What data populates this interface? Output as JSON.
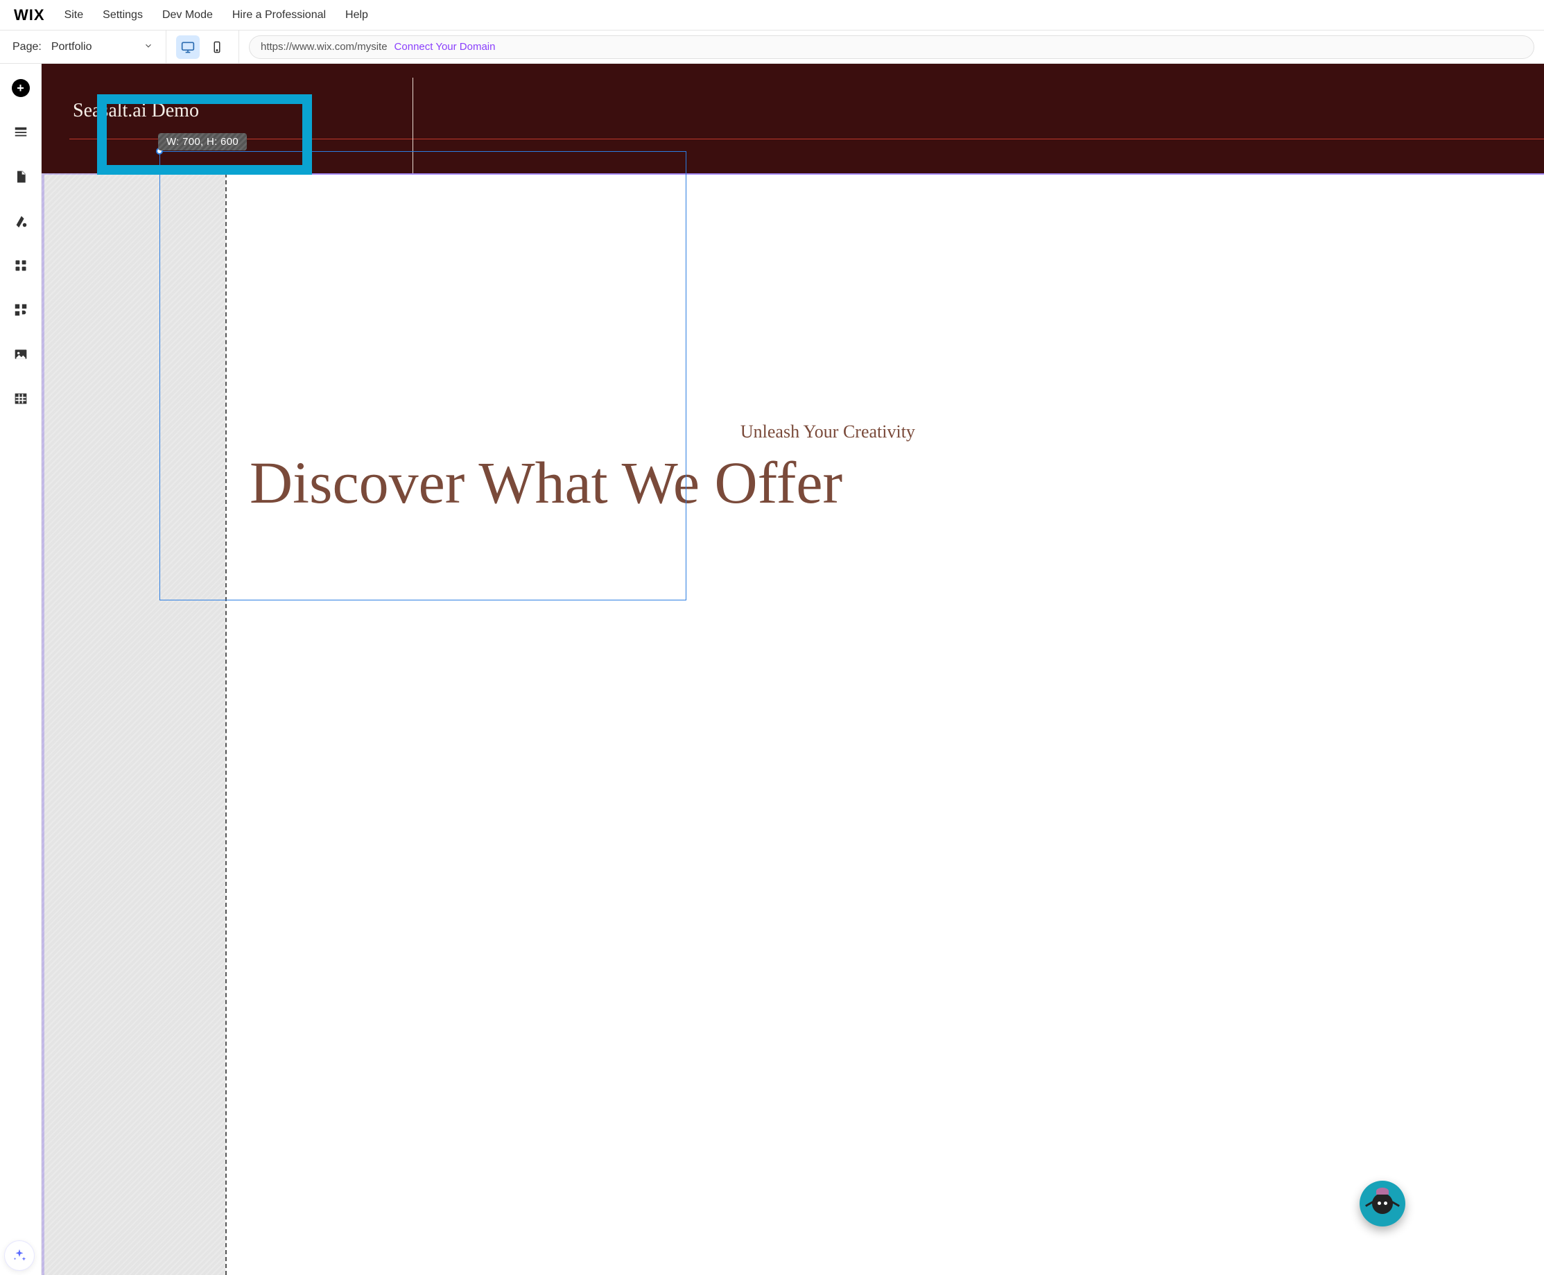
{
  "topMenu": {
    "logo": "WIX",
    "items": [
      "Site",
      "Settings",
      "Dev Mode",
      "Hire a Professional",
      "Help"
    ]
  },
  "pageBar": {
    "label": "Page:",
    "current": "Portfolio"
  },
  "deviceToggle": {
    "desktopActive": true
  },
  "urlBar": {
    "url": "https://www.wix.com/mysite",
    "connectText": "Connect Your Domain"
  },
  "leftRail": {
    "items": [
      "add",
      "sections",
      "pages",
      "theme",
      "apps",
      "addons",
      "media",
      "data"
    ]
  },
  "siteHeader": {
    "title": "Seasalt.ai Demo"
  },
  "selection": {
    "sizeLabel": "W: 700, H: 600"
  },
  "hero": {
    "subtitle": "Unleash Your Creativity",
    "title": "Discover What We Offer"
  }
}
